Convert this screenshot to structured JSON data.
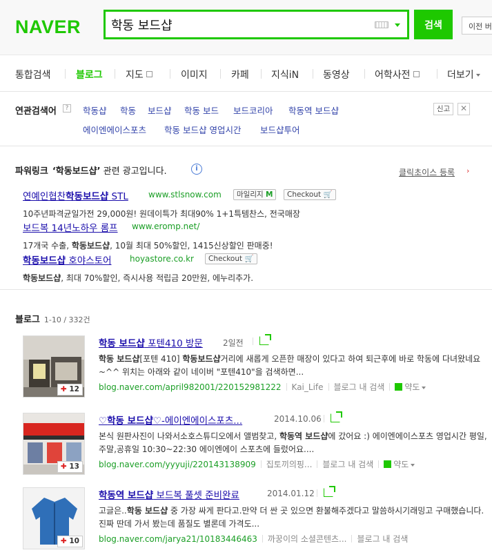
{
  "header": {
    "logo": "NAVER",
    "query": "학동 보드샵",
    "search_button": "검색",
    "prev_button": "이전 버"
  },
  "tabs": [
    {
      "label": "통합검색"
    },
    {
      "label": "블로그"
    },
    {
      "label": "지도"
    },
    {
      "label": "이미지"
    },
    {
      "label": "카페"
    },
    {
      "label": "지식iN"
    },
    {
      "label": "동영상"
    },
    {
      "label": "어학사전"
    },
    {
      "label": "더보기"
    }
  ],
  "related": {
    "title": "연관검색어",
    "help": "?",
    "items": [
      "학동샵",
      "학동",
      "보드샵",
      "학동 보드",
      "보드코리아",
      "학동역 보드샵",
      "에이엔에이스포츠",
      "학동 보드샵 영업시간",
      "보드샵투어"
    ],
    "report": "신고",
    "close": "✕"
  },
  "powerlink": {
    "label": "파워링크",
    "query": "‘학동보드샵’",
    "suffix": "관련 광고입니다.",
    "info": "i",
    "clickchoice": "클릭초이스 등록",
    "ads": [
      {
        "title_pre": "연예인협찬",
        "title_bold": "학동보드샵",
        "title_post": " STL",
        "url": "www.stlsnow.com",
        "badge_mileage": "마일리지",
        "badge_m": "M",
        "badge_checkout": "Checkout",
        "desc_plain": "10주년파격균일가전 29,000원! 원데이특가 최대90% 1+1특템찬스, 전국매장"
      },
      {
        "title_pre": "보드복 14년노하우 롬프",
        "url": "www.eromp.net/",
        "desc_pre": "17개국 수출, ",
        "desc_bold": "학동보드샵",
        "desc_post": ", 10월 최대 50%할인, 1415신상할인 판매중!"
      },
      {
        "title_bold": "학동보드샵",
        "title_post": " 호야스토어",
        "url": "hoyastore.co.kr",
        "badge_checkout": "Checkout",
        "desc_bold": "학동보드샵",
        "desc_post": ", 최대 70%할인, 즉시사용 적립금 20만원, 에누리추가."
      }
    ]
  },
  "blog": {
    "label": "블로그",
    "count": "1-10 / 332건",
    "items": [
      {
        "title_bold": "학동 보드샵",
        "title_post": " 포텐410 방문",
        "date": "2일전",
        "desc_b1": "학동 보드샵",
        "desc_p1": "[포텐 410] ",
        "desc_b2": "학동보드샵",
        "desc_p2": "거리에 새롭게 오픈한 매장이 있다고 하여 퇴근후에 바로 학동에 다녀왔네요~^^ 위치는 아래와 같이 네이버 \"포텐410\"을 검색하면...",
        "url": "blog.naver.com/april982001/220152981222",
        "author": "Kai_Life",
        "in_blog": "블로그 내 검색",
        "yakdo": "약도",
        "thumb_count": "12"
      },
      {
        "title_pre": "♡",
        "title_bold": "학동 보드샵",
        "title_post": "♡-에이엔에이스포츠...",
        "date": "2014.10.06",
        "desc_p1": "본식 원판사진이 나와서소호스튜디오에서 앨범찾고, ",
        "desc_b1": "학동역 보드샵",
        "desc_p2": "에 갔어요 :) 에이엔에이스포츠 영업시간 평일,주말,공휴일 10:30~22:30 에이엔에이 스포츠에 들렀어요....",
        "url": "blog.naver.com/yyyuji/220143138909",
        "author": "집토끼의핑...",
        "in_blog": "블로그 내 검색",
        "yakdo": "약도",
        "thumb_count": "13"
      },
      {
        "title_bold": "학동역 보드샵",
        "title_post": " 보드복 풀셋 준비완료",
        "date": "2014.01.12",
        "desc_p1": "고글은..",
        "desc_b1": "학동 보드샵",
        "desc_p2": " 중 가장 싸게 판다고.만약 더 싼 곳 있으면 환불해주겠다고 말씀하시기래밍고 구매했습니다. 진짜 딴데 가서 봤는데 품질도 별론데 가격도...",
        "url": "blog.naver.com/jarya21/10183446463",
        "author": "까꿍이의 소셜콘텐츠...",
        "in_blog": "블로그 내 검색",
        "thumb_count": "10"
      }
    ]
  }
}
